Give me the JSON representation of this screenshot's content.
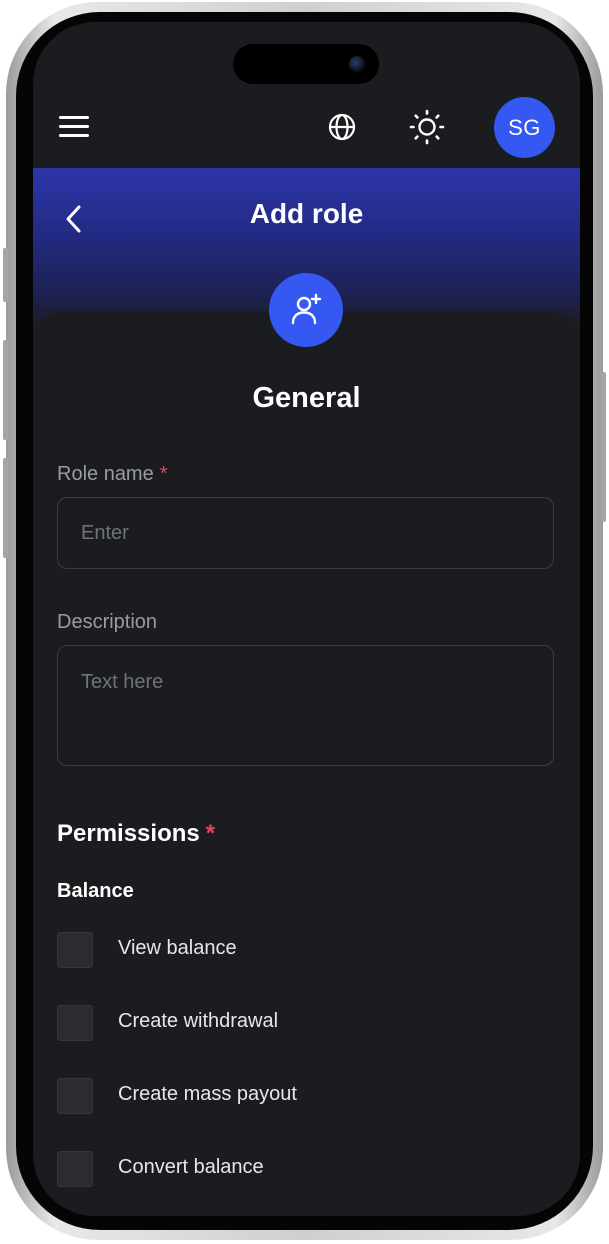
{
  "header": {
    "avatar_initials": "SG",
    "icons": [
      "menu-icon",
      "globe-icon",
      "sun-icon"
    ]
  },
  "page": {
    "title": "Add role",
    "back_icon": "chevron-left-icon",
    "badge_icon": "user-add-icon"
  },
  "form": {
    "section_title": "General",
    "role_name": {
      "label": "Role name",
      "required_mark": "*",
      "placeholder": "Enter",
      "value": ""
    },
    "description": {
      "label": "Description",
      "placeholder": "Text here",
      "value": ""
    }
  },
  "permissions": {
    "title": "Permissions",
    "required_mark": "*",
    "groups": [
      {
        "name": "Balance",
        "items": [
          {
            "label": "View balance",
            "checked": false
          },
          {
            "label": "Create withdrawal",
            "checked": false
          },
          {
            "label": "Create mass payout",
            "checked": false
          },
          {
            "label": "Convert balance",
            "checked": false
          }
        ]
      }
    ]
  },
  "colors": {
    "accent": "#3558f2",
    "background": "#1b1c1f",
    "required": "#e0475a",
    "banner_top": "#2d35a8"
  }
}
